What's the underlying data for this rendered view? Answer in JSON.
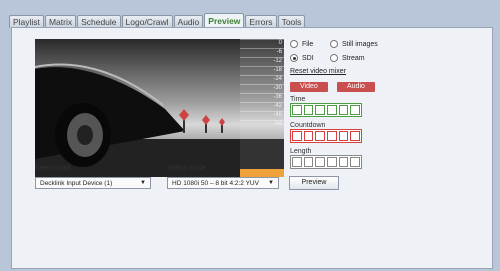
{
  "tabs": [
    "Playlist",
    "Matrix",
    "Schedule",
    "Logo/Crawl",
    "Audio",
    "Preview",
    "Errors",
    "Tools"
  ],
  "active_tab": "Preview",
  "meter": {
    "ticks": [
      "0",
      "-6",
      "-12",
      "-18",
      "-24",
      "-30",
      "-36",
      "-42",
      "-48",
      "-54"
    ],
    "level": 0.06
  },
  "source": {
    "file_label": "File",
    "still_images_label": "Still images",
    "sdi_label": "SDI",
    "stream_label": "Stream",
    "selected": "SDI"
  },
  "reset_video_mixer_label": "Reset video mixer",
  "video_button": "Video",
  "audio_button": "Audio",
  "time_label": "Time",
  "countdown_label": "Countdown",
  "length_label": "Length",
  "select_card_label": "Select card",
  "card_value": "Decklink Input Device (1)",
  "select_mode_label": "Select mode",
  "mode_value": "HD 1080i 50 – 8 bit 4:2:2 YUV",
  "preview_button": "Preview",
  "colors": {
    "accent_green": "#4b9c42",
    "accent_red": "#c94e4e"
  }
}
